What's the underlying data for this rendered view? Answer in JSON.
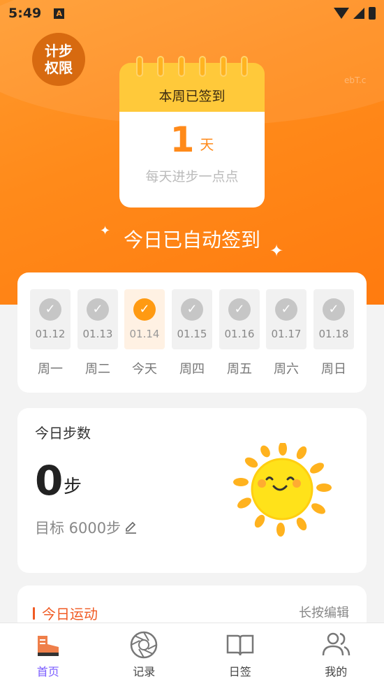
{
  "status_bar": {
    "time": "5:49",
    "notification_icon": "A"
  },
  "header": {
    "permission_badge": [
      "计步",
      "权限"
    ],
    "faint_text": "ebT.c"
  },
  "calendar": {
    "title": "本周已签到",
    "count": "1",
    "unit": "天",
    "subtitle": "每天进步一点点"
  },
  "auto_sign_text": "今日已自动签到",
  "week": [
    {
      "date": "01.12",
      "name": "周一",
      "checked": true,
      "today": false
    },
    {
      "date": "01.13",
      "name": "周二",
      "checked": true,
      "today": false
    },
    {
      "date": "01.14",
      "name": "今天",
      "checked": true,
      "today": true
    },
    {
      "date": "01.15",
      "name": "周四",
      "checked": true,
      "today": false
    },
    {
      "date": "01.16",
      "name": "周五",
      "checked": true,
      "today": false
    },
    {
      "date": "01.17",
      "name": "周六",
      "checked": true,
      "today": false
    },
    {
      "date": "01.18",
      "name": "周日",
      "checked": true,
      "today": false
    }
  ],
  "steps": {
    "title": "今日步数",
    "value": "0",
    "unit": "步",
    "goal": "目标 6000步"
  },
  "sport": {
    "title": "今日运动",
    "edit_hint": "长按编辑"
  },
  "tabs": [
    {
      "label": "首页",
      "icon": "shoe-icon"
    },
    {
      "label": "记录",
      "icon": "aperture-icon"
    },
    {
      "label": "日签",
      "icon": "book-icon"
    },
    {
      "label": "我的",
      "icon": "users-icon"
    }
  ],
  "colors": {
    "accent": "#ff8a1a",
    "calendar_top": "#ffc93a",
    "tab_active": "#7a5cff",
    "sport_title": "#f05a23"
  }
}
